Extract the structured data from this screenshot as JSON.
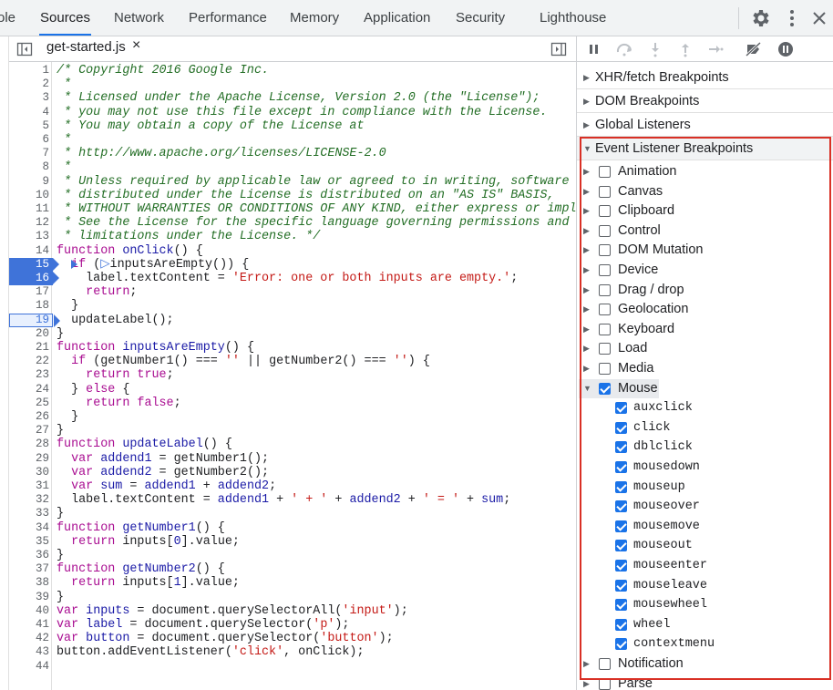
{
  "top_tabs": [
    "ole",
    "Sources",
    "Network",
    "Performance",
    "Memory",
    "Application",
    "Security",
    "Lighthouse"
  ],
  "active_tab": "Sources",
  "file_tab": {
    "name": "get-started.js",
    "close": "×"
  },
  "code_lines": [
    {
      "n": "1",
      "html": "<span class=\"cm\">/* Copyright 2016 Google Inc.</span>"
    },
    {
      "n": "2",
      "html": "<span class=\"cm\"> *</span>"
    },
    {
      "n": "3",
      "html": "<span class=\"cm\"> * Licensed under the Apache License, Version 2.0 (the \"License\");</span>"
    },
    {
      "n": "4",
      "html": "<span class=\"cm\"> * you may not use this file except in compliance with the License.</span>"
    },
    {
      "n": "5",
      "html": "<span class=\"cm\"> * You may obtain a copy of the License at</span>"
    },
    {
      "n": "6",
      "html": "<span class=\"cm\"> *</span>"
    },
    {
      "n": "7",
      "html": "<span class=\"cm\"> * http://www.apache.org/licenses/LICENSE-2.0</span>"
    },
    {
      "n": "8",
      "html": "<span class=\"cm\"> *</span>"
    },
    {
      "n": "9",
      "html": "<span class=\"cm\"> * Unless required by applicable law or agreed to in writing, software</span>"
    },
    {
      "n": "10",
      "html": "<span class=\"cm\"> * distributed under the License is distributed on an \"AS IS\" BASIS,</span>"
    },
    {
      "n": "11",
      "html": "<span class=\"cm\"> * WITHOUT WARRANTIES OR CONDITIONS OF ANY KIND, either express or impli</span>"
    },
    {
      "n": "12",
      "html": "<span class=\"cm\"> * See the License for the specific language governing permissions and</span>"
    },
    {
      "n": "13",
      "html": "<span class=\"cm\"> * limitations under the License. */</span>"
    },
    {
      "n": "14",
      "html": "<span class=\"kw\">function</span> <span class=\"fn\">onClick</span>() {"
    },
    {
      "n": "15",
      "html": "  <span class=\"kw\">if</span> (<span style=\"color:#3f73d9\">▷</span>inputsAreEmpty()) {"
    },
    {
      "n": "16",
      "html": "    label.textContent = <span class=\"st\">'Error: one or both inputs are empty.'</span>;"
    },
    {
      "n": "17",
      "html": "    <span class=\"kw\">return</span>;"
    },
    {
      "n": "18",
      "html": "  }"
    },
    {
      "n": "19",
      "html": "  updateLabel();"
    },
    {
      "n": "20",
      "html": "}"
    },
    {
      "n": "21",
      "html": "<span class=\"kw\">function</span> <span class=\"fn\">inputsAreEmpty</span>() {"
    },
    {
      "n": "22",
      "html": "  <span class=\"kw\">if</span> (getNumber1() === <span class=\"st\">''</span> || getNumber2() === <span class=\"st\">''</span>) {"
    },
    {
      "n": "23",
      "html": "    <span class=\"kw\">return true</span>;"
    },
    {
      "n": "24",
      "html": "  } <span class=\"kw\">else</span> {"
    },
    {
      "n": "25",
      "html": "    <span class=\"kw\">return false</span>;"
    },
    {
      "n": "26",
      "html": "  }"
    },
    {
      "n": "27",
      "html": "}"
    },
    {
      "n": "28",
      "html": "<span class=\"kw\">function</span> <span class=\"fn\">updateLabel</span>() {"
    },
    {
      "n": "29",
      "html": "  <span class=\"kw\">var</span> <span class=\"vr\">addend1</span> = getNumber1();"
    },
    {
      "n": "30",
      "html": "  <span class=\"kw\">var</span> <span class=\"vr\">addend2</span> = getNumber2();"
    },
    {
      "n": "31",
      "html": "  <span class=\"kw\">var</span> <span class=\"vr\">sum</span> = <span class=\"vr\">addend1</span> + <span class=\"vr\">addend2</span>;"
    },
    {
      "n": "32",
      "html": "  label.textContent = <span class=\"vr\">addend1</span> + <span class=\"st\">' + '</span> + <span class=\"vr\">addend2</span> + <span class=\"st\">' = '</span> + <span class=\"vr\">sum</span>;"
    },
    {
      "n": "33",
      "html": "}"
    },
    {
      "n": "34",
      "html": "<span class=\"kw\">function</span> <span class=\"fn\">getNumber1</span>() {"
    },
    {
      "n": "35",
      "html": "  <span class=\"kw\">return</span> inputs[<span class=\"vr\">0</span>].value;"
    },
    {
      "n": "36",
      "html": "}"
    },
    {
      "n": "37",
      "html": "<span class=\"kw\">function</span> <span class=\"fn\">getNumber2</span>() {"
    },
    {
      "n": "38",
      "html": "  <span class=\"kw\">return</span> inputs[<span class=\"vr\">1</span>].value;"
    },
    {
      "n": "39",
      "html": "}"
    },
    {
      "n": "40",
      "html": "<span class=\"kw\">var</span> <span class=\"vr\">inputs</span> = document.querySelectorAll(<span class=\"st\">'input'</span>);"
    },
    {
      "n": "41",
      "html": "<span class=\"kw\">var</span> <span class=\"vr\">label</span> = document.querySelector(<span class=\"st\">'p'</span>);"
    },
    {
      "n": "42",
      "html": "<span class=\"kw\">var</span> <span class=\"vr\">button</span> = document.querySelector(<span class=\"st\">'button'</span>);"
    },
    {
      "n": "43",
      "html": "button.addEventListener(<span class=\"st\">'click'</span>, onClick);"
    },
    {
      "n": "44",
      "html": ""
    }
  ],
  "breakpoints": {
    "full": [
      "15",
      "16"
    ],
    "outline": [
      "19"
    ]
  },
  "sections": [
    "XHR/fetch Breakpoints",
    "DOM Breakpoints",
    "Global Listeners",
    "Event Listener Breakpoints"
  ],
  "categories": [
    {
      "label": "Animation",
      "checked": false
    },
    {
      "label": "Canvas",
      "checked": false
    },
    {
      "label": "Clipboard",
      "checked": false
    },
    {
      "label": "Control",
      "checked": false
    },
    {
      "label": "DOM Mutation",
      "checked": false
    },
    {
      "label": "Device",
      "checked": false
    },
    {
      "label": "Drag / drop",
      "checked": false
    },
    {
      "label": "Geolocation",
      "checked": false
    },
    {
      "label": "Keyboard",
      "checked": false
    },
    {
      "label": "Load",
      "checked": false
    },
    {
      "label": "Media",
      "checked": false
    },
    {
      "label": "Mouse",
      "checked": true,
      "expanded": true
    },
    {
      "label": "Notification",
      "checked": false
    },
    {
      "label": "Parse",
      "checked": false
    }
  ],
  "mouse_events": [
    "auxclick",
    "click",
    "dblclick",
    "mousedown",
    "mouseup",
    "mouseover",
    "mousemove",
    "mouseout",
    "mouseenter",
    "mouseleave",
    "mousewheel",
    "wheel",
    "contextmenu"
  ],
  "colors": {
    "accent": "#1a73e8",
    "breakpoint": "#3f73d9",
    "highlight_box": "#d93025"
  }
}
